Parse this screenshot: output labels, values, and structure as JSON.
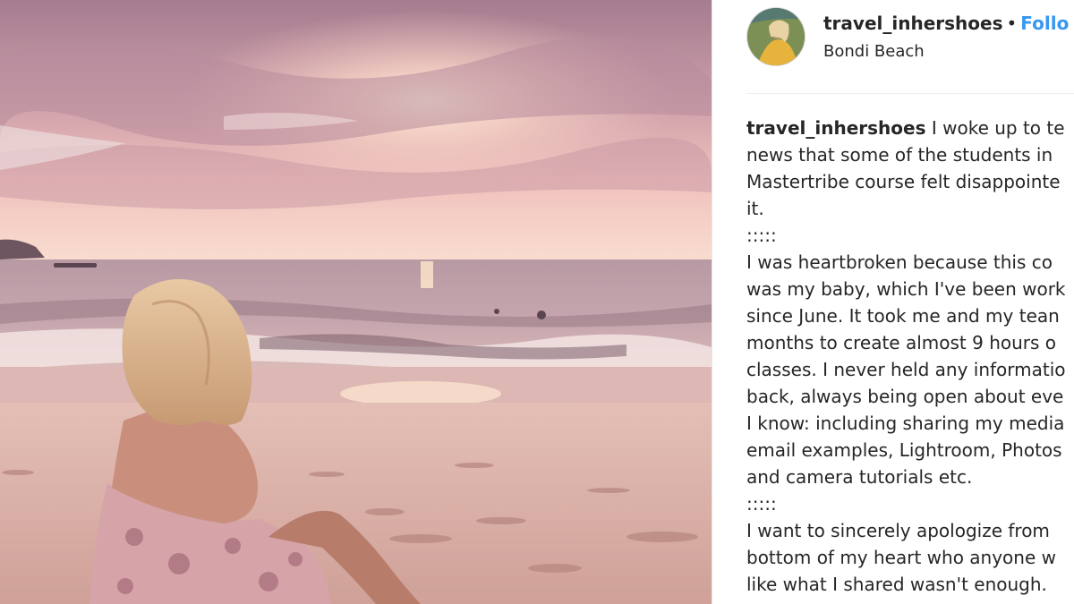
{
  "post": {
    "username": "travel_inhershoes",
    "separator": "•",
    "follow_label": "Follo",
    "location": "Bondi Beach"
  },
  "photo": {
    "description_icon": "beach-sunset-photo"
  },
  "caption": {
    "author": "travel_inhershoes",
    "lines": [
      " I woke up to te",
      "news that some of the students in",
      "Mastertribe course felt disappointe",
      "it.",
      ":::::",
      "I was heartbroken because this co",
      "was my baby, which I've been work",
      "since June. It took me and my tean",
      "months to create almost 9 hours o",
      "classes. I never held any informatio",
      "back, always being open about eve",
      "I know: including sharing my media",
      "email examples, Lightroom, Photos",
      "and camera tutorials etc.",
      ":::::",
      "I want to sincerely apologize from",
      "bottom of my heart who anyone w",
      "like what I shared wasn't enough."
    ]
  },
  "colors": {
    "follow": "#3897f0",
    "text": "#262626"
  }
}
